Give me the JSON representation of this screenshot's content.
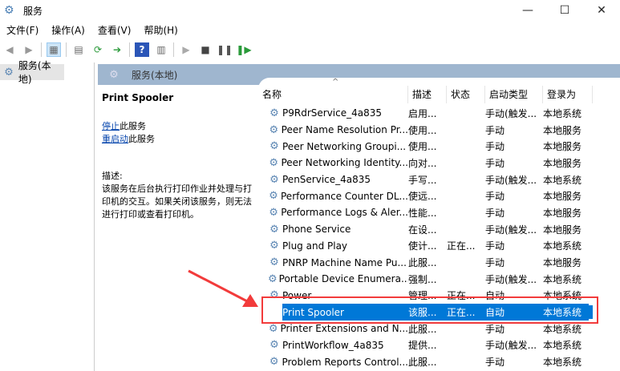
{
  "window": {
    "title": "服务",
    "minimize": "—",
    "maximize": "☐",
    "close": "✕"
  },
  "menu": [
    "文件(F)",
    "操作(A)",
    "查看(V)",
    "帮助(H)"
  ],
  "toolbar_icons": [
    "back-icon",
    "forward-icon",
    "console-tree-icon",
    "properties-icon",
    "refresh-icon",
    "export-icon",
    "help-icon",
    "view-icon",
    "start-icon",
    "stop-icon",
    "pause-icon",
    "resume-icon"
  ],
  "tree": {
    "root": "服务(本地)"
  },
  "panel": {
    "header": "服务(本地)"
  },
  "details": {
    "service_name": "Print Spooler",
    "stop_link": "停止",
    "stop_suffix": "此服务",
    "restart_link": "重启动",
    "restart_suffix": "此服务",
    "desc_label": "描述:",
    "description": "该服务在后台执行打印作业并处理与打印机的交互。如果关闭该服务，则无法进行打印或查看打印机。"
  },
  "columns": [
    "名称",
    "描述",
    "状态",
    "启动类型",
    "登录为"
  ],
  "rows": [
    {
      "name": "P9RdrService_4a835",
      "desc": "启用...",
      "status": "",
      "startup": "手动(触发...",
      "logon": "本地系统"
    },
    {
      "name": "Peer Name Resolution Pr...",
      "desc": "使用...",
      "status": "",
      "startup": "手动",
      "logon": "本地服务"
    },
    {
      "name": "Peer Networking Groupi...",
      "desc": "使用...",
      "status": "",
      "startup": "手动",
      "logon": "本地服务"
    },
    {
      "name": "Peer Networking Identity...",
      "desc": "向对...",
      "status": "",
      "startup": "手动",
      "logon": "本地服务"
    },
    {
      "name": "PenService_4a835",
      "desc": "手写...",
      "status": "",
      "startup": "手动(触发...",
      "logon": "本地系统"
    },
    {
      "name": "Performance Counter DL...",
      "desc": "使远...",
      "status": "",
      "startup": "手动",
      "logon": "本地服务"
    },
    {
      "name": "Performance Logs & Aler...",
      "desc": "性能...",
      "status": "",
      "startup": "手动",
      "logon": "本地服务"
    },
    {
      "name": "Phone Service",
      "desc": "在设...",
      "status": "",
      "startup": "手动(触发...",
      "logon": "本地服务"
    },
    {
      "name": "Plug and Play",
      "desc": "使计...",
      "status": "正在...",
      "startup": "手动",
      "logon": "本地系统"
    },
    {
      "name": "PNRP Machine Name Pu...",
      "desc": "此服...",
      "status": "",
      "startup": "手动",
      "logon": "本地服务"
    },
    {
      "name": "Portable Device Enumera...",
      "desc": "强制...",
      "status": "",
      "startup": "手动(触发...",
      "logon": "本地系统"
    },
    {
      "name": "Power",
      "desc": "管理...",
      "status": "正在...",
      "startup": "自动",
      "logon": "本地系统"
    },
    {
      "name": "Print Spooler",
      "desc": "该服...",
      "status": "正在...",
      "startup": "自动",
      "logon": "本地系统",
      "selected": true
    },
    {
      "name": "Printer Extensions and N...",
      "desc": "此服...",
      "status": "",
      "startup": "手动",
      "logon": "本地系统"
    },
    {
      "name": "PrintWorkflow_4a835",
      "desc": "提供...",
      "status": "",
      "startup": "手动(触发...",
      "logon": "本地系统"
    },
    {
      "name": "Problem Reports Control...",
      "desc": "此服...",
      "status": "",
      "startup": "手动",
      "logon": "本地系统"
    }
  ],
  "colors": {
    "selection": "#0078d7",
    "highlight": "#f23b3b",
    "header_band": "#9fb6cf"
  }
}
